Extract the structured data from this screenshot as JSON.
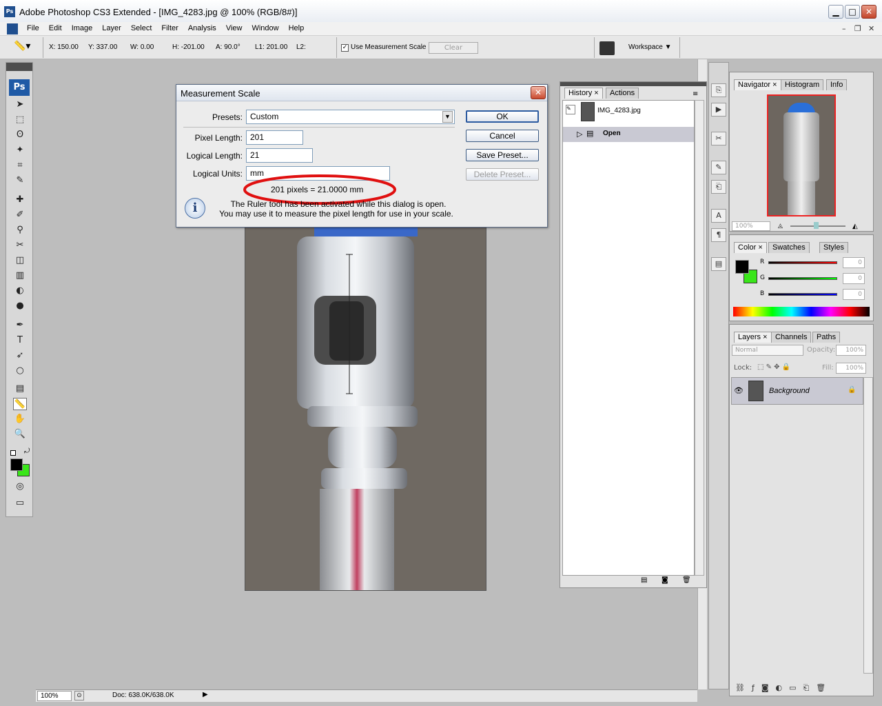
{
  "window": {
    "title": "Adobe Photoshop CS3 Extended - [IMG_4283.jpg @ 100% (RGB/8#)]",
    "app_icon_text": "Ps",
    "minimize": "▁",
    "maximize": "□",
    "close": "✕"
  },
  "menu": {
    "items": [
      "File",
      "Edit",
      "Image",
      "Layer",
      "Select",
      "Filter",
      "Analysis",
      "View",
      "Window",
      "Help"
    ],
    "mdi_min": "–",
    "mdi_restore": "❐",
    "mdi_close": "✕"
  },
  "options_bar": {
    "x": "X: 150.00",
    "y": "Y: 337.00",
    "w": "W: 0.00",
    "h": "H: -201.00",
    "a": "A: 90.0°",
    "l1": "L1: 201.00",
    "l2": "L2:",
    "use_scale_label": "Use Measurement Scale",
    "use_scale_checked": "✓",
    "clear_label": "Clear",
    "workspace_label": "Workspace ▼"
  },
  "tools": {
    "ps_logo": "Ps",
    "items": [
      "➤",
      "⬚",
      "ʘ",
      "✦",
      "⌗",
      "✎",
      "✚",
      "✐",
      "⚲",
      "✂",
      "◫",
      "▥",
      "◐",
      "●",
      "✒",
      "T",
      "➶",
      "○",
      "▤",
      "📏",
      "✋",
      "🔍"
    ]
  },
  "dialog": {
    "title": "Measurement Scale",
    "presets_label": "Presets:",
    "presets_value": "Custom",
    "pixel_length_label": "Pixel Length:",
    "pixel_length_value": "201",
    "logical_length_label": "Logical Length:",
    "logical_length_value": "21",
    "logical_units_label": "Logical Units:",
    "logical_units_value": "mm",
    "result": "201 pixels = 21.0000 mm",
    "info_line1": "The Ruler tool has been activated while this dialog is open.",
    "info_line2": "You may use it to measure the pixel length for use in your scale.",
    "ok": "OK",
    "cancel": "Cancel",
    "save_preset": "Save Preset...",
    "delete_preset": "Delete Preset..."
  },
  "history": {
    "tabs": [
      "History",
      "Actions"
    ],
    "snapshot": "IMG_4283.jpg",
    "state": "Open"
  },
  "navigator": {
    "tabs": [
      "Navigator",
      "Histogram",
      "Info"
    ],
    "zoom": "100%"
  },
  "color_panel": {
    "tabs": [
      "Color",
      "Swatches",
      "Styles"
    ],
    "r_label": "R",
    "g_label": "G",
    "b_label": "B",
    "r_value": "0",
    "g_value": "0",
    "b_value": "0"
  },
  "layers": {
    "tabs": [
      "Layers",
      "Channels",
      "Paths"
    ],
    "blend_mode": "Normal",
    "opacity_label": "Opacity:",
    "opacity_value": "100%",
    "lock_label": "Lock:",
    "fill_label": "Fill:",
    "fill_value": "100%",
    "layer_name": "Background"
  },
  "status": {
    "zoom": "100%",
    "doc": "Doc: 638.0K/638.0K"
  },
  "colors": {
    "foreground": "#000000",
    "background": "#3ae61a",
    "annotation_red": "#e01010"
  }
}
